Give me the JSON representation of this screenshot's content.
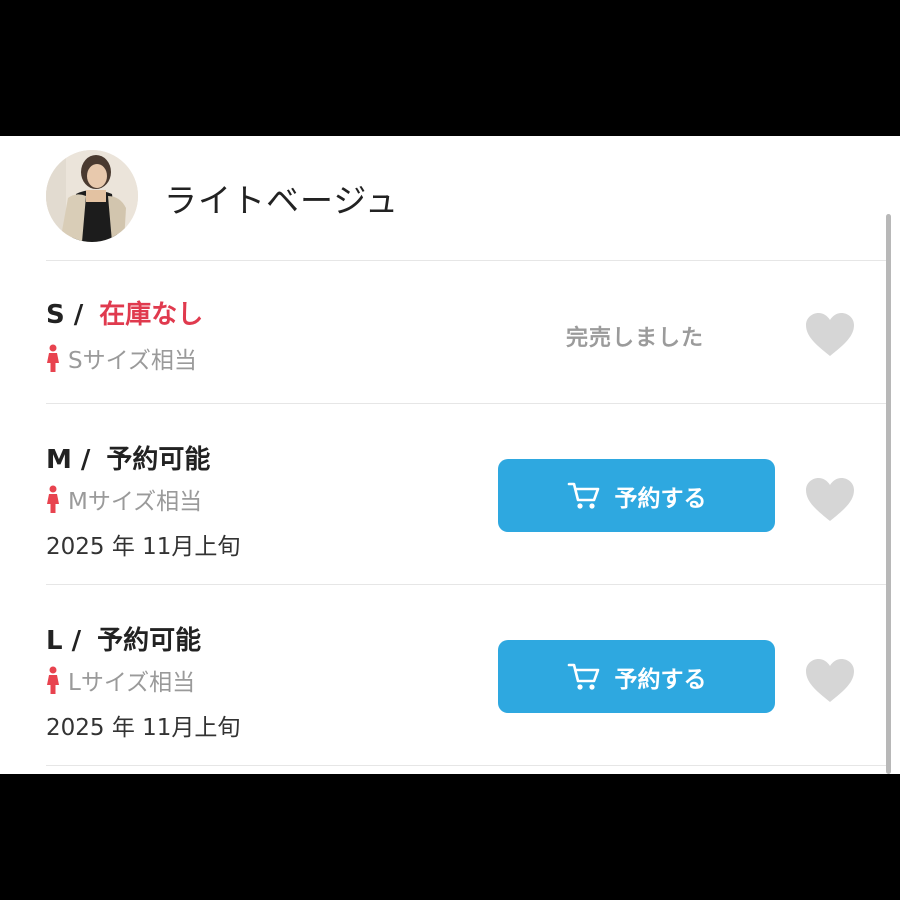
{
  "product": {
    "color_name": "ライトベージュ"
  },
  "sizes": [
    {
      "code": "S /",
      "status": "在庫なし",
      "fit": "Sサイズ相当",
      "action": "完売しました"
    },
    {
      "code": "M /",
      "status": "予約可能",
      "fit": "Mサイズ相当",
      "date": "2025 年 11月上旬",
      "button": "予約する"
    },
    {
      "code": "L /",
      "status": "予約可能",
      "fit": "Lサイズ相当",
      "date": "2025 年 11月上旬",
      "button": "予約する"
    }
  ],
  "icons": {
    "person": "person-icon",
    "cart": "cart-icon",
    "heart": "heart-icon"
  },
  "colors": {
    "accent": "#2ea8e0",
    "out_of_stock": "#e03a4e",
    "person_icon": "#e8434f",
    "heart": "#d6d6d6"
  }
}
